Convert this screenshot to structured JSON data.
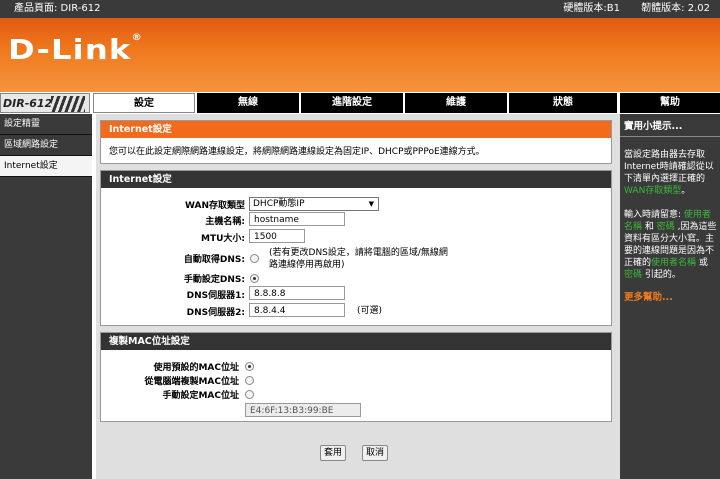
{
  "topbar": {
    "product_page": "產品頁面: DIR-612",
    "hw_version": "硬體版本:B1",
    "fw_version": "韌體版本: 2.02"
  },
  "brand": {
    "logo": "D-Link",
    "reg_mark": "®"
  },
  "model_badge": "DIR-612",
  "tabs": [
    {
      "label": "設定"
    },
    {
      "label": "無線"
    },
    {
      "label": "進階設定"
    },
    {
      "label": "維護"
    },
    {
      "label": "狀態"
    },
    {
      "label": "幫助"
    }
  ],
  "sidebar": {
    "items": [
      {
        "label": "設定精靈"
      },
      {
        "label": "區域網路設定"
      },
      {
        "label": "Internet設定"
      }
    ]
  },
  "intro": {
    "title": "Internet設定",
    "text": "您可以在此設定網際網路連線設定，將網際網路連線設定為固定IP、DHCP或PPPoE連線方式。"
  },
  "internet": {
    "title": "Internet設定",
    "wan_type_label": "WAN存取類型",
    "wan_type_value": "DHCP動態IP",
    "hostname_label": "主機名稱:",
    "hostname_value": "hostname",
    "mtu_label": "MTU大小:",
    "mtu_value": "1500",
    "auto_dns_label": "自動取得DNS:",
    "auto_dns_note1": "(若有更改DNS設定，請將電腦的區域/無線網",
    "auto_dns_note2": "路連線停用再啟用)",
    "manual_dns_label": "手動設定DNS:",
    "dns1_label": "DNS伺服器1:",
    "dns1_value": "8.8.8.8",
    "dns2_label": "DNS伺服器2:",
    "dns2_value": "8.8.4.4",
    "dns2_optional": "(可選)"
  },
  "mac": {
    "title": "複製MAC位址設定",
    "default_label": "使用預設的MAC位址",
    "clone_label": "從電腦端複製MAC位址",
    "manual_label": "手動設定MAC位址",
    "mac_value": "E4:6F:13:B3:99:BE"
  },
  "buttons": {
    "apply": "套用",
    "cancel": "取消"
  },
  "help": {
    "title": "實用小提示...",
    "p1_a": "當設定路由器去存取Internet時請確認從以下清單內選擇正確的",
    "p1_hl": "WAN存取類型",
    "p1_b": "。",
    "p2_a": "輸入時請留意: ",
    "p2_hl1": "使用者名稱",
    "p2_mid": " 和 ",
    "p2_hl2": "密碼",
    "p2_b": " ,因為這些資料有區分大小寫。主要的連線問題是因為不正確的",
    "p2_hl3": "使用者名稱",
    "p2_or": " 或 ",
    "p2_hl4": "密碼",
    "p2_c": " 引起的。",
    "more": "更多幫助..."
  },
  "colors": {
    "accent": "#f26b1d",
    "dark": "#3a3a3a",
    "help_highlight": "#3cb83c"
  }
}
